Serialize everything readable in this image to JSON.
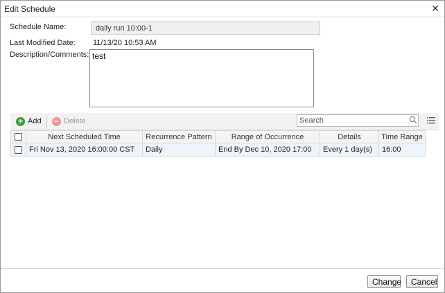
{
  "dialog": {
    "title": "Edit Schedule",
    "close_icon": "close-icon"
  },
  "form": {
    "schedule_name_label": "Schedule Name:",
    "schedule_name_value": "daily run 10:00-1",
    "last_modified_label": "Last Modified Date:",
    "last_modified_value": "11/13/20 10:53 AM",
    "description_label": "Description/Comments:",
    "description_value": "test"
  },
  "toolbar": {
    "add_label": "Add",
    "delete_label": "Delete",
    "search_placeholder": "Search"
  },
  "table": {
    "columns": [
      "Next Scheduled Time",
      "Recurrence Pattern",
      "Range of Occurrence",
      "Details",
      "Time Range"
    ],
    "rows": [
      [
        "Fri Nov 13, 2020 16:00:00 CST",
        "Daily",
        "End By Dec 10, 2020 17:00",
        "Every 1 day(s)",
        "16:00"
      ]
    ]
  },
  "footer": {
    "change_label": "Change",
    "cancel_label": "Cancel"
  },
  "colors": {
    "add_icon": "#3aa13a",
    "delete_icon": "#e99a9a",
    "row_highlight": "#eef4fb"
  }
}
